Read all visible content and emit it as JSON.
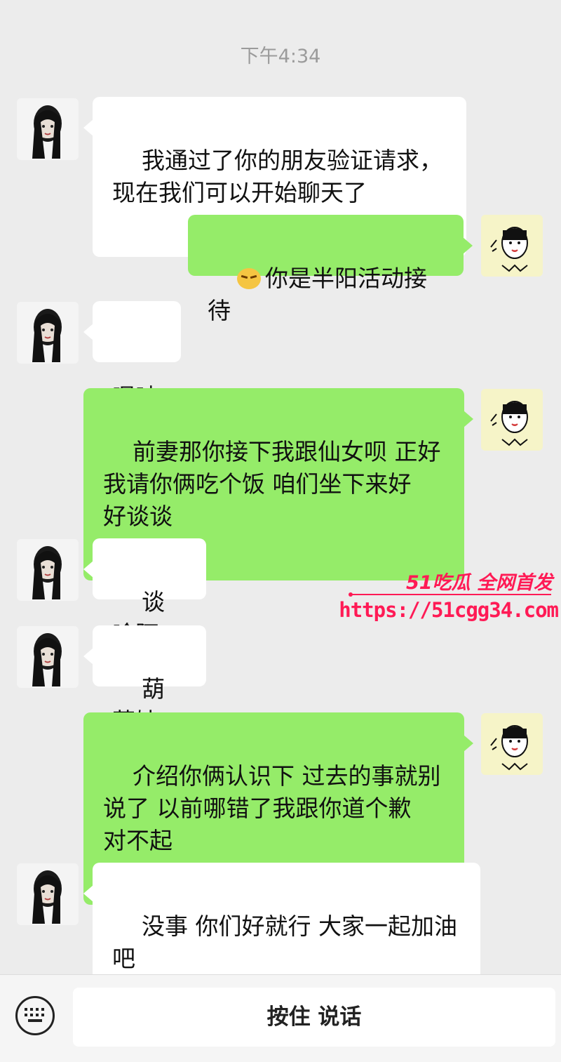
{
  "chat": {
    "timestamp": "下午4:34",
    "messages": [
      {
        "side": "left",
        "text": "我通过了你的朋友验证请求，\n现在我们可以开始聊天了"
      },
      {
        "side": "right",
        "text": "你是半阳活动接待",
        "emoji": "smirk-emoji"
      },
      {
        "side": "left",
        "text": "嗯呐"
      },
      {
        "side": "right",
        "text": "前妻那你接下我跟仙女呗 正好\n我请你俩吃个饭 咱们坐下来好\n好谈谈"
      },
      {
        "side": "left",
        "text": "谈啥阿"
      },
      {
        "side": "left",
        "text": "葫芦娃"
      },
      {
        "side": "right",
        "text": "介绍你俩认识下 过去的事就别\n说了 以前哪错了我跟你道个歉\n对不起"
      },
      {
        "side": "left",
        "text": "没事 你们好就行 大家一起加油\n吧"
      }
    ]
  },
  "watermark": {
    "brand": "51吃瓜 全网首发",
    "url": "https://51cgg34.com"
  },
  "input_bar": {
    "keyboard_icon": "keyboard-icon",
    "hold_to_talk_label": "按住 说话"
  },
  "colors": {
    "background": "#ececec",
    "outgoing_bubble": "#95ec69",
    "incoming_bubble": "#ffffff",
    "watermark": "#ff1a55"
  }
}
